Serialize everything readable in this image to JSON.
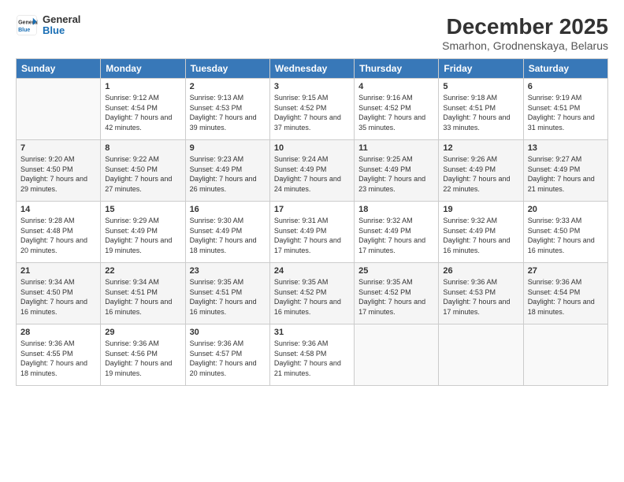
{
  "logo": {
    "line1": "General",
    "line2": "Blue"
  },
  "title": "December 2025",
  "subtitle": "Smarhon, Grodnenskaya, Belarus",
  "weekdays": [
    "Sunday",
    "Monday",
    "Tuesday",
    "Wednesday",
    "Thursday",
    "Friday",
    "Saturday"
  ],
  "weeks": [
    [
      {
        "day": "",
        "sunrise": "",
        "sunset": "",
        "daylight": ""
      },
      {
        "day": "1",
        "sunrise": "Sunrise: 9:12 AM",
        "sunset": "Sunset: 4:54 PM",
        "daylight": "Daylight: 7 hours and 42 minutes."
      },
      {
        "day": "2",
        "sunrise": "Sunrise: 9:13 AM",
        "sunset": "Sunset: 4:53 PM",
        "daylight": "Daylight: 7 hours and 39 minutes."
      },
      {
        "day": "3",
        "sunrise": "Sunrise: 9:15 AM",
        "sunset": "Sunset: 4:52 PM",
        "daylight": "Daylight: 7 hours and 37 minutes."
      },
      {
        "day": "4",
        "sunrise": "Sunrise: 9:16 AM",
        "sunset": "Sunset: 4:52 PM",
        "daylight": "Daylight: 7 hours and 35 minutes."
      },
      {
        "day": "5",
        "sunrise": "Sunrise: 9:18 AM",
        "sunset": "Sunset: 4:51 PM",
        "daylight": "Daylight: 7 hours and 33 minutes."
      },
      {
        "day": "6",
        "sunrise": "Sunrise: 9:19 AM",
        "sunset": "Sunset: 4:51 PM",
        "daylight": "Daylight: 7 hours and 31 minutes."
      }
    ],
    [
      {
        "day": "7",
        "sunrise": "Sunrise: 9:20 AM",
        "sunset": "Sunset: 4:50 PM",
        "daylight": "Daylight: 7 hours and 29 minutes."
      },
      {
        "day": "8",
        "sunrise": "Sunrise: 9:22 AM",
        "sunset": "Sunset: 4:50 PM",
        "daylight": "Daylight: 7 hours and 27 minutes."
      },
      {
        "day": "9",
        "sunrise": "Sunrise: 9:23 AM",
        "sunset": "Sunset: 4:49 PM",
        "daylight": "Daylight: 7 hours and 26 minutes."
      },
      {
        "day": "10",
        "sunrise": "Sunrise: 9:24 AM",
        "sunset": "Sunset: 4:49 PM",
        "daylight": "Daylight: 7 hours and 24 minutes."
      },
      {
        "day": "11",
        "sunrise": "Sunrise: 9:25 AM",
        "sunset": "Sunset: 4:49 PM",
        "daylight": "Daylight: 7 hours and 23 minutes."
      },
      {
        "day": "12",
        "sunrise": "Sunrise: 9:26 AM",
        "sunset": "Sunset: 4:49 PM",
        "daylight": "Daylight: 7 hours and 22 minutes."
      },
      {
        "day": "13",
        "sunrise": "Sunrise: 9:27 AM",
        "sunset": "Sunset: 4:49 PM",
        "daylight": "Daylight: 7 hours and 21 minutes."
      }
    ],
    [
      {
        "day": "14",
        "sunrise": "Sunrise: 9:28 AM",
        "sunset": "Sunset: 4:48 PM",
        "daylight": "Daylight: 7 hours and 20 minutes."
      },
      {
        "day": "15",
        "sunrise": "Sunrise: 9:29 AM",
        "sunset": "Sunset: 4:49 PM",
        "daylight": "Daylight: 7 hours and 19 minutes."
      },
      {
        "day": "16",
        "sunrise": "Sunrise: 9:30 AM",
        "sunset": "Sunset: 4:49 PM",
        "daylight": "Daylight: 7 hours and 18 minutes."
      },
      {
        "day": "17",
        "sunrise": "Sunrise: 9:31 AM",
        "sunset": "Sunset: 4:49 PM",
        "daylight": "Daylight: 7 hours and 17 minutes."
      },
      {
        "day": "18",
        "sunrise": "Sunrise: 9:32 AM",
        "sunset": "Sunset: 4:49 PM",
        "daylight": "Daylight: 7 hours and 17 minutes."
      },
      {
        "day": "19",
        "sunrise": "Sunrise: 9:32 AM",
        "sunset": "Sunset: 4:49 PM",
        "daylight": "Daylight: 7 hours and 16 minutes."
      },
      {
        "day": "20",
        "sunrise": "Sunrise: 9:33 AM",
        "sunset": "Sunset: 4:50 PM",
        "daylight": "Daylight: 7 hours and 16 minutes."
      }
    ],
    [
      {
        "day": "21",
        "sunrise": "Sunrise: 9:34 AM",
        "sunset": "Sunset: 4:50 PM",
        "daylight": "Daylight: 7 hours and 16 minutes."
      },
      {
        "day": "22",
        "sunrise": "Sunrise: 9:34 AM",
        "sunset": "Sunset: 4:51 PM",
        "daylight": "Daylight: 7 hours and 16 minutes."
      },
      {
        "day": "23",
        "sunrise": "Sunrise: 9:35 AM",
        "sunset": "Sunset: 4:51 PM",
        "daylight": "Daylight: 7 hours and 16 minutes."
      },
      {
        "day": "24",
        "sunrise": "Sunrise: 9:35 AM",
        "sunset": "Sunset: 4:52 PM",
        "daylight": "Daylight: 7 hours and 16 minutes."
      },
      {
        "day": "25",
        "sunrise": "Sunrise: 9:35 AM",
        "sunset": "Sunset: 4:52 PM",
        "daylight": "Daylight: 7 hours and 17 minutes."
      },
      {
        "day": "26",
        "sunrise": "Sunrise: 9:36 AM",
        "sunset": "Sunset: 4:53 PM",
        "daylight": "Daylight: 7 hours and 17 minutes."
      },
      {
        "day": "27",
        "sunrise": "Sunrise: 9:36 AM",
        "sunset": "Sunset: 4:54 PM",
        "daylight": "Daylight: 7 hours and 18 minutes."
      }
    ],
    [
      {
        "day": "28",
        "sunrise": "Sunrise: 9:36 AM",
        "sunset": "Sunset: 4:55 PM",
        "daylight": "Daylight: 7 hours and 18 minutes."
      },
      {
        "day": "29",
        "sunrise": "Sunrise: 9:36 AM",
        "sunset": "Sunset: 4:56 PM",
        "daylight": "Daylight: 7 hours and 19 minutes."
      },
      {
        "day": "30",
        "sunrise": "Sunrise: 9:36 AM",
        "sunset": "Sunset: 4:57 PM",
        "daylight": "Daylight: 7 hours and 20 minutes."
      },
      {
        "day": "31",
        "sunrise": "Sunrise: 9:36 AM",
        "sunset": "Sunset: 4:58 PM",
        "daylight": "Daylight: 7 hours and 21 minutes."
      },
      {
        "day": "",
        "sunrise": "",
        "sunset": "",
        "daylight": ""
      },
      {
        "day": "",
        "sunrise": "",
        "sunset": "",
        "daylight": ""
      },
      {
        "day": "",
        "sunrise": "",
        "sunset": "",
        "daylight": ""
      }
    ]
  ]
}
